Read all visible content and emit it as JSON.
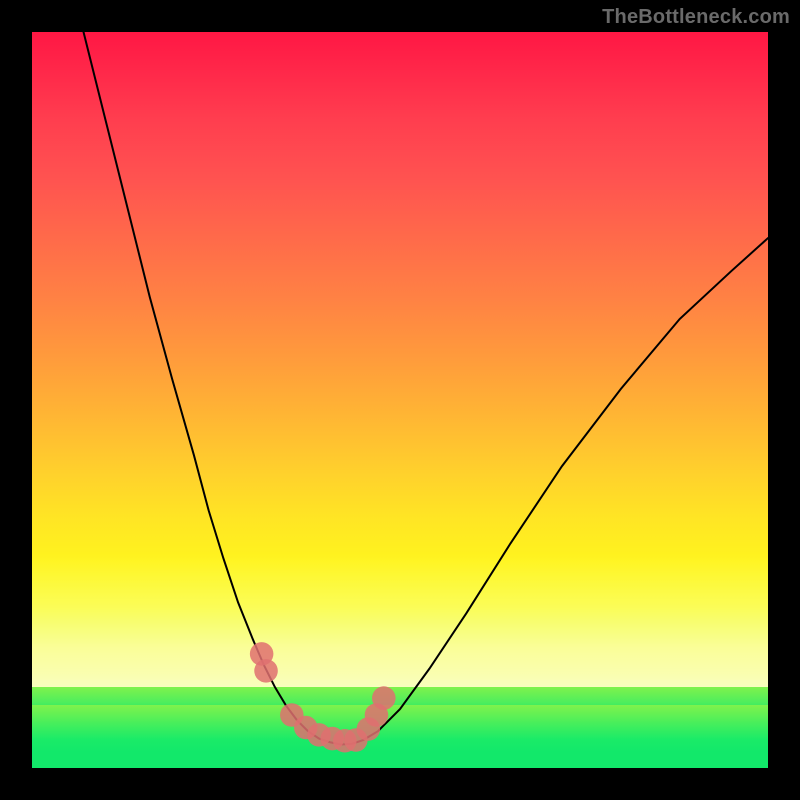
{
  "watermark": "TheBottleneck.com",
  "chart_data": {
    "type": "line",
    "title": "",
    "xlabel": "",
    "ylabel": "",
    "xlim": [
      0,
      100
    ],
    "ylim": [
      0,
      100
    ],
    "grid": false,
    "series": [
      {
        "name": "left-curve",
        "x": [
          7,
          10,
          13,
          16,
          19,
          22,
          24,
          26,
          28,
          30,
          31.5,
          33,
          34.5,
          36,
          37.5,
          39,
          40.5
        ],
        "values": [
          100,
          88,
          76,
          64,
          53,
          42.5,
          35,
          28.5,
          22.5,
          17.5,
          14,
          11,
          8.5,
          6.5,
          5,
          4,
          3.5
        ]
      },
      {
        "name": "valley-floor",
        "x": [
          40.5,
          42,
          43.5,
          45
        ],
        "values": [
          3.5,
          3.2,
          3.3,
          3.8
        ]
      },
      {
        "name": "right-curve",
        "x": [
          45,
          47,
          50,
          54,
          59,
          65,
          72,
          80,
          88,
          95,
          100
        ],
        "values": [
          3.8,
          5,
          8,
          13.5,
          21,
          30.5,
          41,
          51.5,
          61,
          67.5,
          72
        ]
      }
    ],
    "markers": {
      "name": "data-points",
      "color": "#df7070",
      "x": [
        31.2,
        31.8,
        35.3,
        37.2,
        39.0,
        40.8,
        42.5,
        44.0,
        45.7,
        46.8,
        47.8
      ],
      "y": [
        15.5,
        13.2,
        7.2,
        5.5,
        4.5,
        4.0,
        3.7,
        3.8,
        5.3,
        7.2,
        9.5
      ]
    },
    "gradient_stops": [
      {
        "pct": 0,
        "color": "#ff1744"
      },
      {
        "pct": 20,
        "color": "#ff5350"
      },
      {
        "pct": 44,
        "color": "#ff9a3c"
      },
      {
        "pct": 72,
        "color": "#fff41e"
      },
      {
        "pct": 93,
        "color": "#12e86a"
      },
      {
        "pct": 100,
        "color": "#12e86a"
      }
    ]
  }
}
